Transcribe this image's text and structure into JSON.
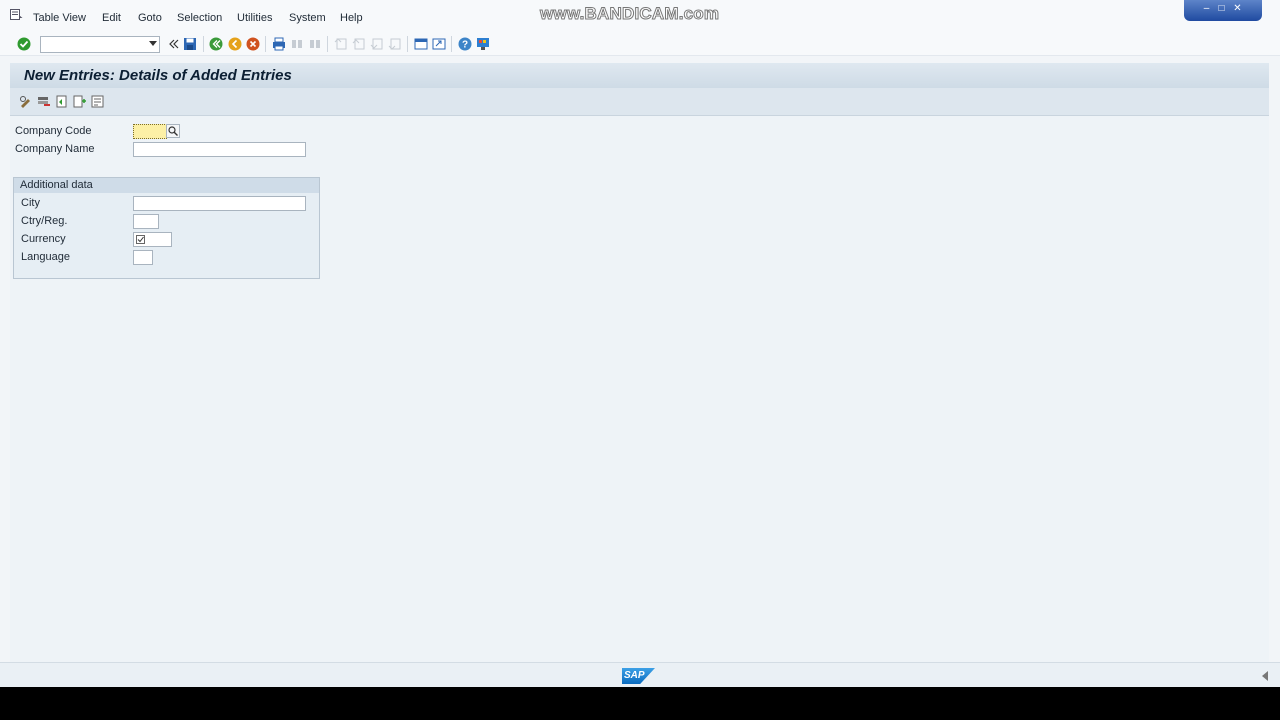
{
  "menubar": {
    "items": [
      "Table View",
      "Edit",
      "Goto",
      "Selection",
      "Utilities",
      "System",
      "Help"
    ],
    "watermark": "www.BANDICAM.com"
  },
  "toolbar": {
    "command_field_value": "",
    "icons": [
      "enter-icon",
      "save-icon",
      "back-icon",
      "exit-icon",
      "cancel-icon",
      "print-icon",
      "find-icon",
      "find-next-icon",
      "first-page-icon",
      "previous-page-icon",
      "next-page-icon",
      "last-page-icon",
      "new-session-icon",
      "shortcut-icon",
      "help-icon",
      "customize-layout-icon"
    ]
  },
  "screen": {
    "title": "New Entries: Details of Added Entries"
  },
  "form": {
    "company_code_label": "Company Code",
    "company_code_value": "",
    "company_name_label": "Company Name",
    "company_name_value": "",
    "additional_data": {
      "title": "Additional data",
      "city_label": "City",
      "city_value": "",
      "country_label": "Ctry/Reg.",
      "country_value": "",
      "currency_label": "Currency",
      "currency_value": "",
      "language_label": "Language",
      "language_value": ""
    }
  },
  "status": {
    "logo_text": "SAP"
  },
  "colors": {
    "title_text": "#0c1f33",
    "focus_field": "#fcf0a6",
    "background": "#eef3f7"
  }
}
